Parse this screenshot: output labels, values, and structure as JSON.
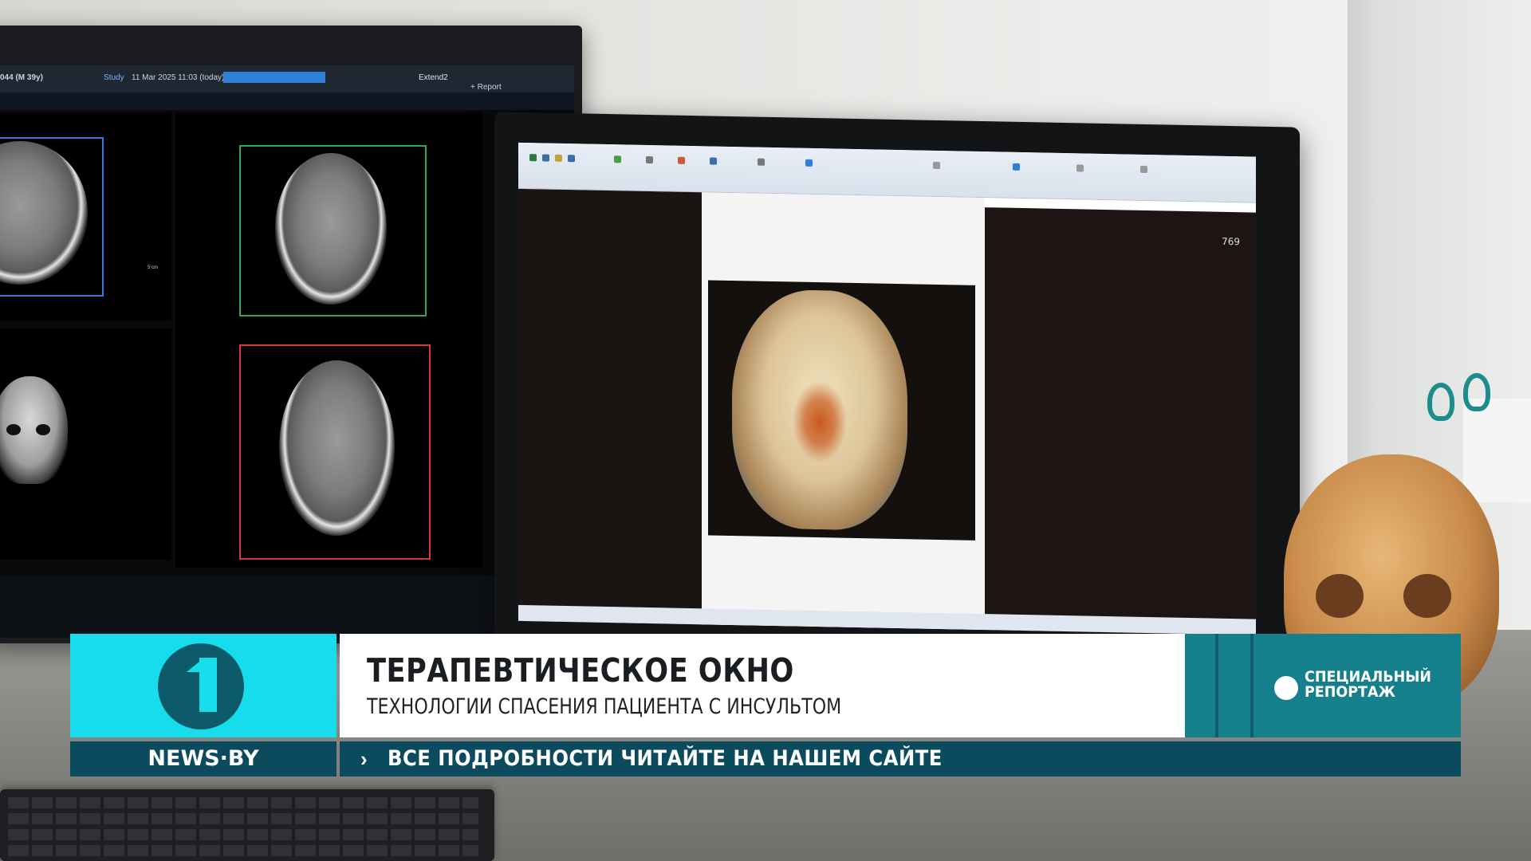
{
  "scene": {
    "left_monitor": {
      "patient": "044 (M 39y)",
      "study_label": "Study",
      "study_date": "11 Mar 2025 11:03 (today)",
      "extend_label": "Extend2",
      "report_label": "+ Report",
      "scale_label": "5 cm",
      "viewer_icons": [
        "undo-icon",
        "redo-icon",
        "home-icon",
        "ruler-icon"
      ]
    },
    "right_monitor": {
      "frame_counter": "769"
    }
  },
  "lower_third": {
    "title": "ТЕРАПЕВТИЧЕСКОЕ ОКНО",
    "subtitle": "ТЕХНОЛОГИИ СПАСЕНИЯ ПАЦИЕНТА С ИНСУЛЬТОМ",
    "badge_line1": "СПЕЦИАЛЬНЫЙ",
    "badge_line2": "РЕПОРТАЖ",
    "channel_logo": "channel-one-logo"
  },
  "ticker": {
    "brand": "NEWS·BY",
    "arrow": "›",
    "text": "ВСЕ ПОДРОБНОСТИ ЧИТАЙТЕ НА НАШЕМ САЙТЕ"
  },
  "colors": {
    "logo_cyan": "#17dceb",
    "logo_dark": "#0d5a6b",
    "badge_teal": "#157f8c",
    "ticker_navy": "#0c4a5e",
    "title_panel": "#ffffff"
  }
}
